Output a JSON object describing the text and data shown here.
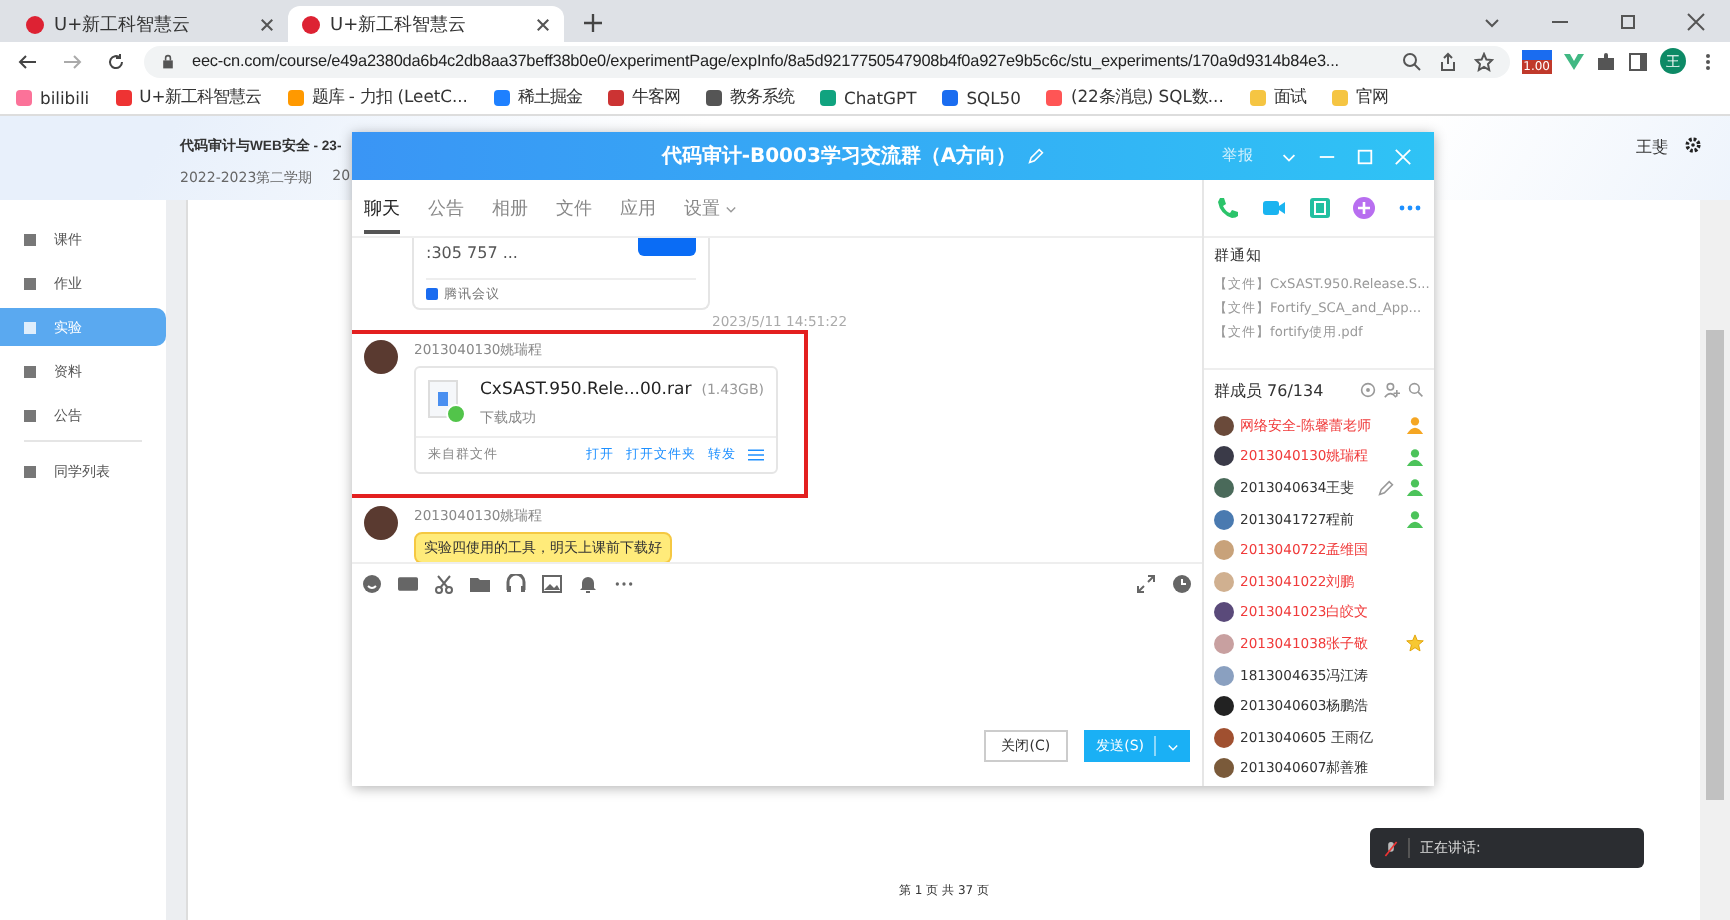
{
  "browser": {
    "tabs": [
      {
        "title": "U+新工科智慧云",
        "selected": false
      },
      {
        "title": "U+新工科智慧云",
        "selected": true
      }
    ],
    "url": "eec-cn.com/course/e49a2380da6b4c2db8aa37beff38b0e0/experimentPage/expInfo/8a5d9217750547908b4f0a927e9b5c6c/stu_experiments/170a9d9314b84e3...",
    "extension_badge": "1.00",
    "profile": "王",
    "bookmarks": [
      "bilibili",
      "U+新工科智慧云",
      "题库 - 力扣 (LeetC...",
      "稀土掘金",
      "牛客网",
      "教务系统",
      "ChatGPT",
      "SQL50",
      "(22条消息) SQL数...",
      "面试",
      "官网"
    ]
  },
  "page": {
    "course_title": "代码审计与WEB安全 - 23-",
    "term": "2022-2023第二学期",
    "term_2": "20",
    "user": "王斐",
    "nav": [
      {
        "label": "课件",
        "selected": false
      },
      {
        "label": "作业",
        "selected": false
      },
      {
        "label": "实验",
        "selected": true
      },
      {
        "label": "资料",
        "selected": false
      },
      {
        "label": "公告",
        "selected": false
      },
      {
        "label": "同学列表",
        "selected": false
      }
    ],
    "page_counter": "第 1 页 共 37 页"
  },
  "chat": {
    "title": "代码审计-B0003学习交流群（A方向）",
    "report": "举报",
    "tabs": [
      {
        "label": "聊天",
        "selected": true
      },
      {
        "label": "公告",
        "selected": false
      },
      {
        "label": "相册",
        "selected": false
      },
      {
        "label": "文件",
        "selected": false
      },
      {
        "label": "应用",
        "selected": false
      },
      {
        "label": "设置",
        "selected": false
      }
    ],
    "meeting_card": {
      "text": ":305 757 ...",
      "source": "腾讯会议"
    },
    "timestamp": "2023/5/11 14:51:22",
    "file_message": {
      "sender": "2013040130姚瑞程",
      "file_name": "CxSAST.950.Rele...00.rar",
      "size": "(1.43GB)",
      "status": "下载成功",
      "origin": "来自群文件",
      "actions": [
        "打开",
        "打开文件夹",
        "转发"
      ]
    },
    "text_message": {
      "sender": "2013040130姚瑞程",
      "text": "实验四使用的工具，明天上课前下载好"
    },
    "buttons": {
      "close": "关闭(C)",
      "send": "发送(S)"
    },
    "notice": {
      "title": "群通知",
      "items": [
        "【文件】CxSAST.950.Release.S...",
        "【文件】Fortify_SCA_and_App...",
        "【文件】fortify使用.pdf"
      ]
    },
    "members_title": "群成员 76/134",
    "members": [
      {
        "name": "网络安全-陈馨蕾老师",
        "color": "#f03a3a",
        "owner": true,
        "admin": false,
        "starred": false,
        "editable": false
      },
      {
        "name": "2013040130姚瑞程",
        "color": "#f03a3a",
        "owner": false,
        "admin": true,
        "starred": false,
        "editable": false
      },
      {
        "name": "2013040634王斐",
        "color": "#333333",
        "owner": false,
        "admin": true,
        "starred": false,
        "editable": true
      },
      {
        "name": "2013041727程前",
        "color": "#333333",
        "owner": false,
        "admin": true,
        "starred": false,
        "editable": false
      },
      {
        "name": "2013040722孟维国",
        "color": "#f03a3a",
        "owner": false,
        "admin": false,
        "starred": false,
        "editable": false
      },
      {
        "name": "2013041022刘鹏",
        "color": "#f03a3a",
        "owner": false,
        "admin": false,
        "starred": false,
        "editable": false
      },
      {
        "name": "2013041023白皎文",
        "color": "#f03a3a",
        "owner": false,
        "admin": false,
        "starred": false,
        "editable": false
      },
      {
        "name": "2013041038张子敬",
        "color": "#f03a3a",
        "owner": false,
        "admin": false,
        "starred": true,
        "editable": false
      },
      {
        "name": "1813004635冯江涛",
        "color": "#333333",
        "owner": false,
        "admin": false,
        "starred": false,
        "editable": false
      },
      {
        "name": "2013040603杨鹏浩",
        "color": "#333333",
        "owner": false,
        "admin": false,
        "starred": false,
        "editable": false
      },
      {
        "name": "2013040605 王雨亿",
        "color": "#333333",
        "owner": false,
        "admin": false,
        "starred": false,
        "editable": false
      },
      {
        "name": "2013040607郝善雅",
        "color": "#333333",
        "owner": false,
        "admin": false,
        "starred": false,
        "editable": false
      }
    ]
  },
  "voice_popup": {
    "text": "正在讲话:"
  }
}
